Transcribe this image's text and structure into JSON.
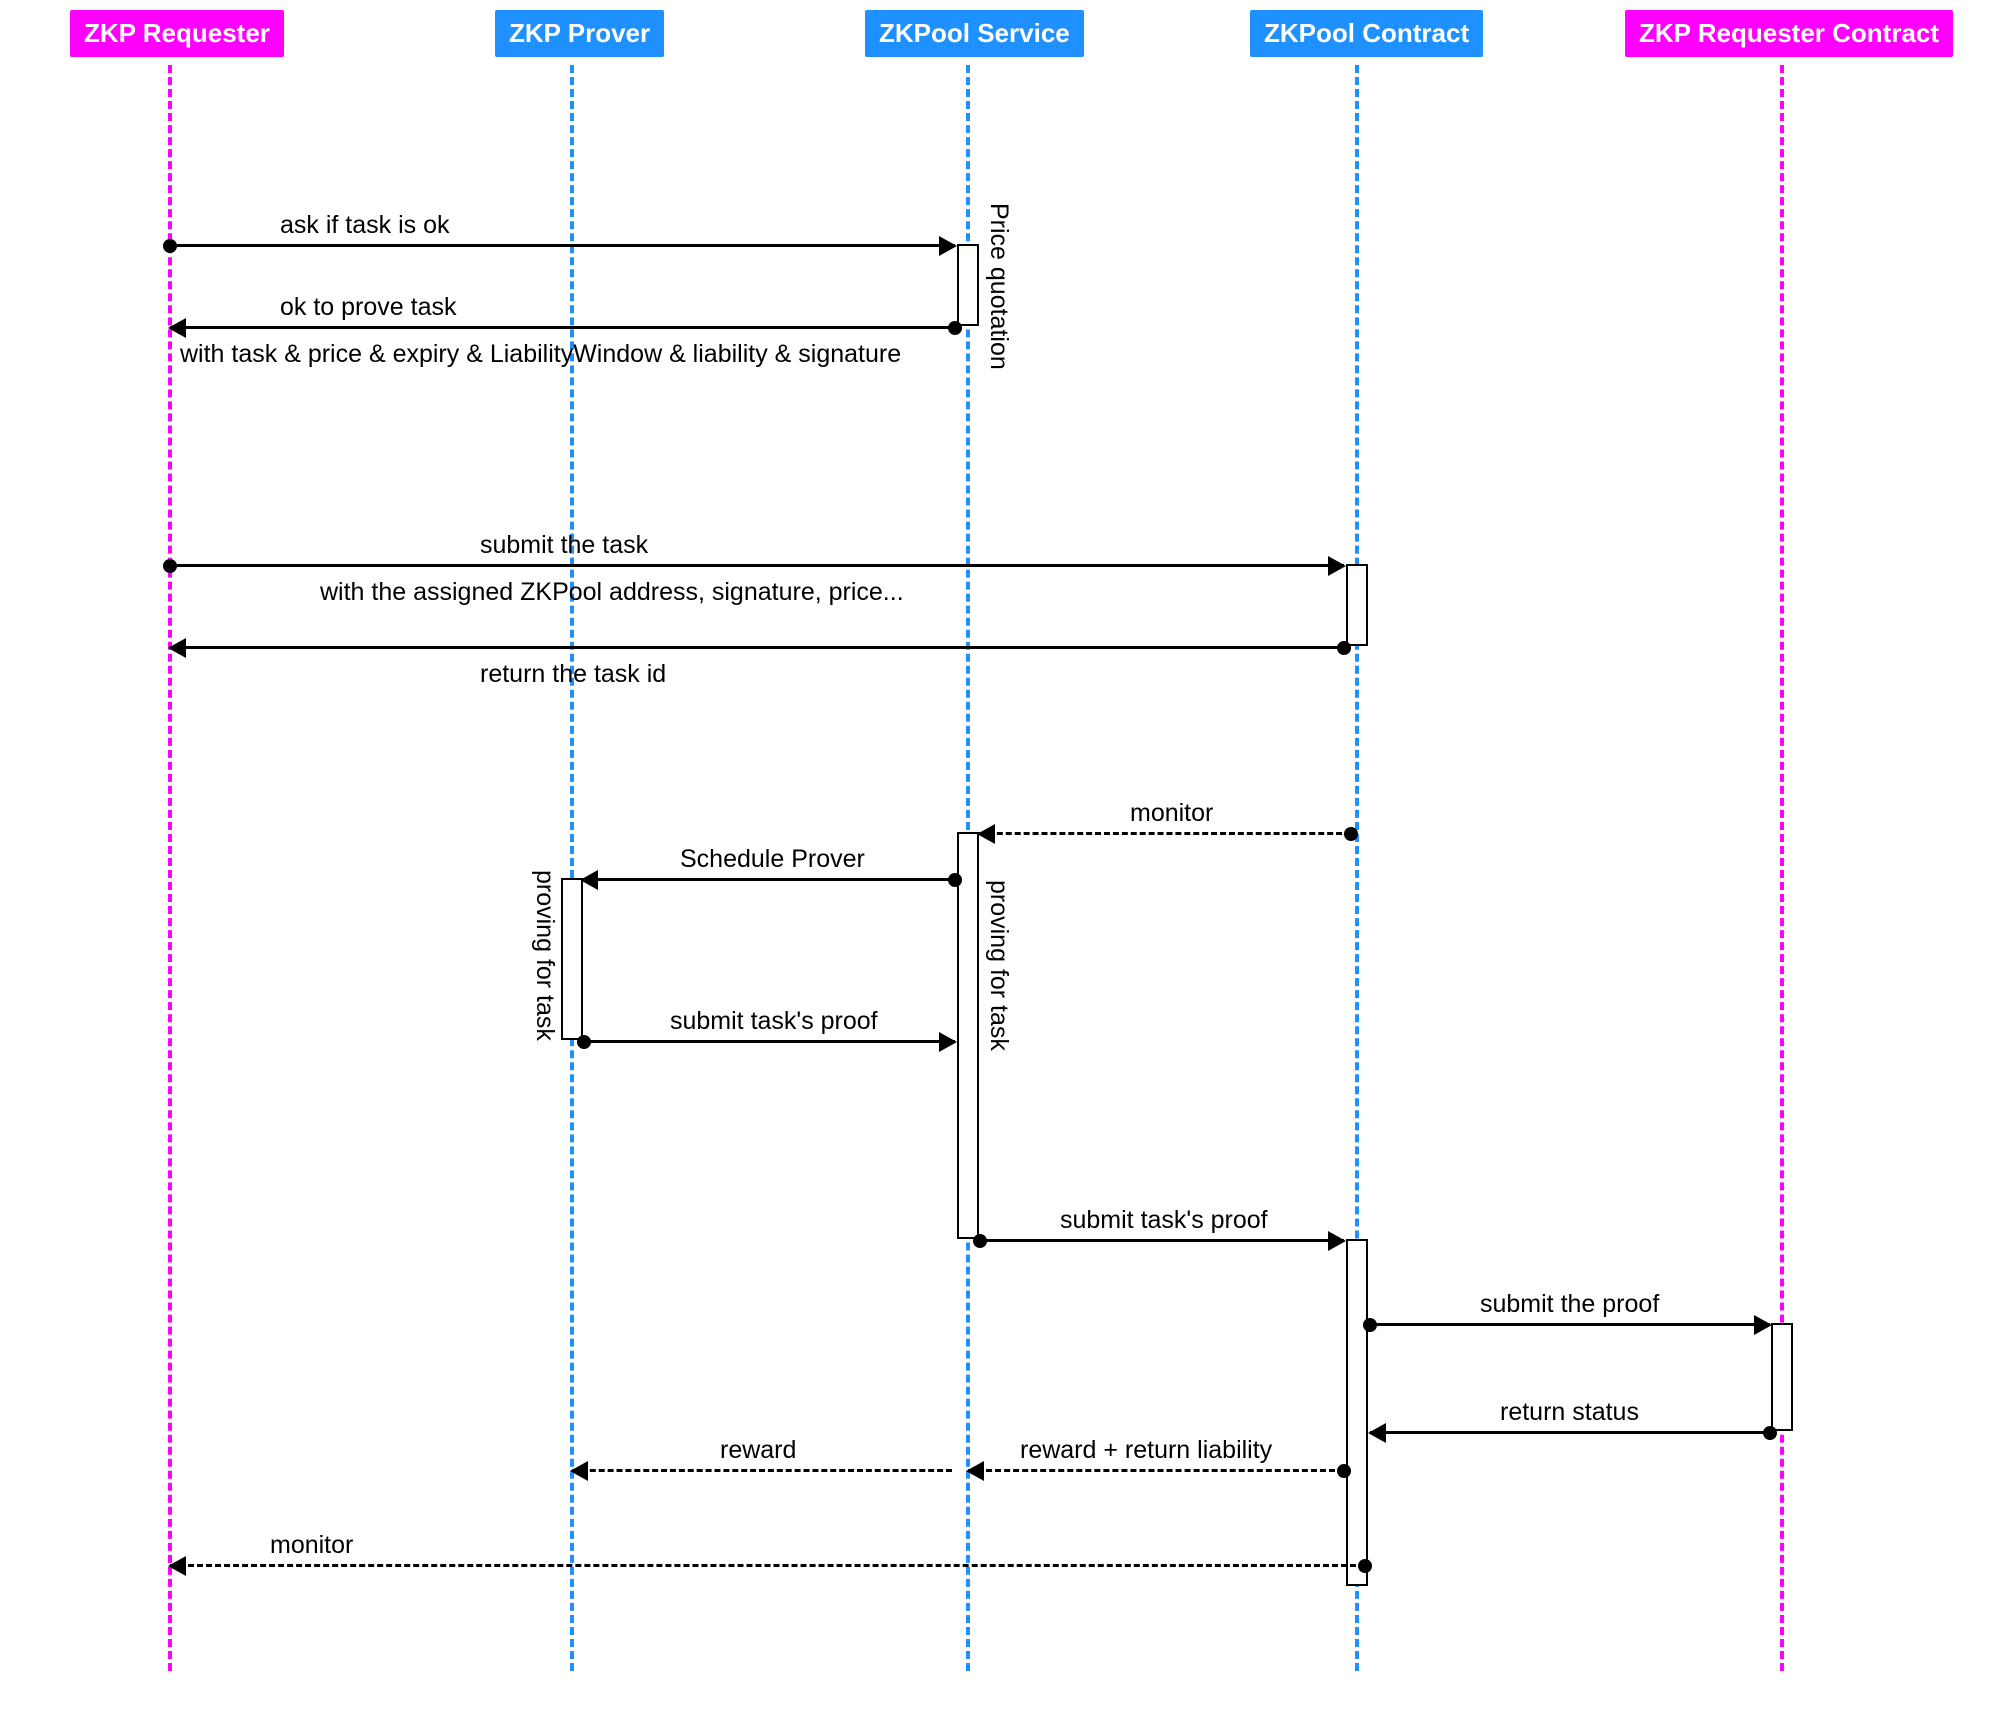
{
  "participants": {
    "requester": {
      "label": "ZKP Requester",
      "color": "#ff00ff"
    },
    "prover": {
      "label": "ZKP Prover",
      "color": "#1e90ff"
    },
    "service": {
      "label": "ZKPool Service",
      "color": "#1e90ff"
    },
    "contract": {
      "label": "ZKPool Contract",
      "color": "#1e90ff"
    },
    "reqcontract": {
      "label": "ZKP Requester Contract",
      "color": "#ff00ff"
    }
  },
  "messages": {
    "ask_task": "ask if task is ok",
    "ok_to_prove": "ok to prove task",
    "with_quote": "with task & price & expiry & LiabilityWindow & liability & signature",
    "price_quotation": "Price quotation",
    "submit_task": "submit the task",
    "with_assigned": "with the assigned ZKPool address, signature, price...",
    "return_task_id": "return the task id",
    "monitor1": "monitor",
    "schedule_prover": "Schedule Prover",
    "proving_for_task_left": "proving for task",
    "proving_for_task_right": "proving for task",
    "submit_proof_prover": "submit task's proof",
    "submit_proof_service": "submit task's proof",
    "submit_the_proof": "submit the proof",
    "return_status": "return status",
    "reward_liability": "reward + return liability",
    "reward": "reward",
    "monitor2": "monitor"
  }
}
